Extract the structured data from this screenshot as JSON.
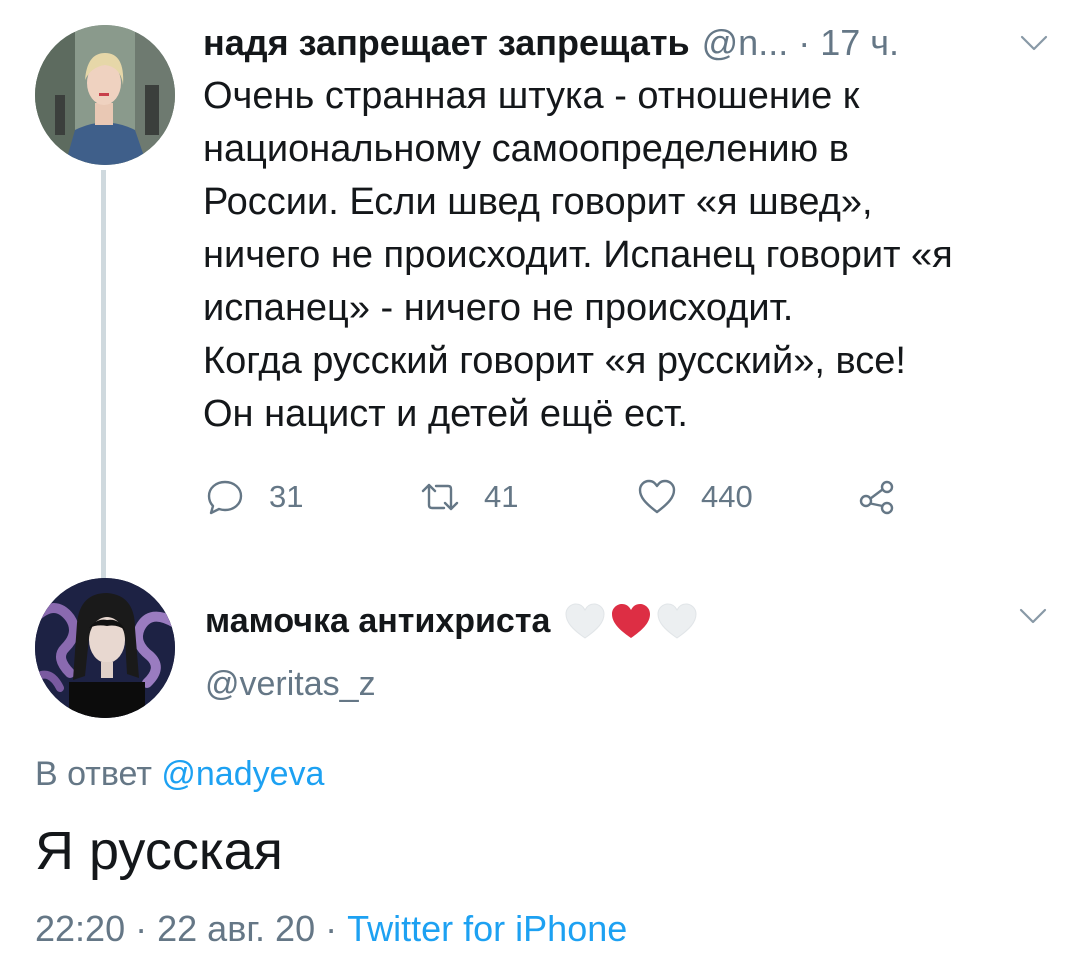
{
  "tweet1": {
    "author_name": "надя запрещает запрещать",
    "handle_time": "@n... · 17 ч.",
    "text": "Очень странная штука - отношение к\nнациональному самоопределению в\nРоссии. Если швед говорит «я швед»,\nничего не происходит. Испанец говорит «я\nиспанец» - ничего не происходит.\nКогда русский говорит «я русский», все!\nОн нацист и детей ещё ест.",
    "replies": "31",
    "retweets": "41",
    "likes": "440",
    "icons": [
      "reply-icon",
      "retweet-icon",
      "like-icon",
      "share-icon",
      "chevron-down-icon"
    ]
  },
  "tweet2": {
    "author_name": "мамочка антихриста",
    "handle": "@veritas_z",
    "reply_prefix": "В ответ",
    "reply_mention": "@nadyeva",
    "text": "Я русская",
    "time": "22:20",
    "separator": "·",
    "date": "22 авг. 20",
    "source": "Twitter for iPhone",
    "emoji": [
      "white-heart",
      "red-heart",
      "white-heart"
    ]
  },
  "colors": {
    "text": "#14171a",
    "secondary": "#657786",
    "link": "#1da1f2",
    "thread_line": "#cfd9de",
    "heart_red": "#e0245e"
  }
}
